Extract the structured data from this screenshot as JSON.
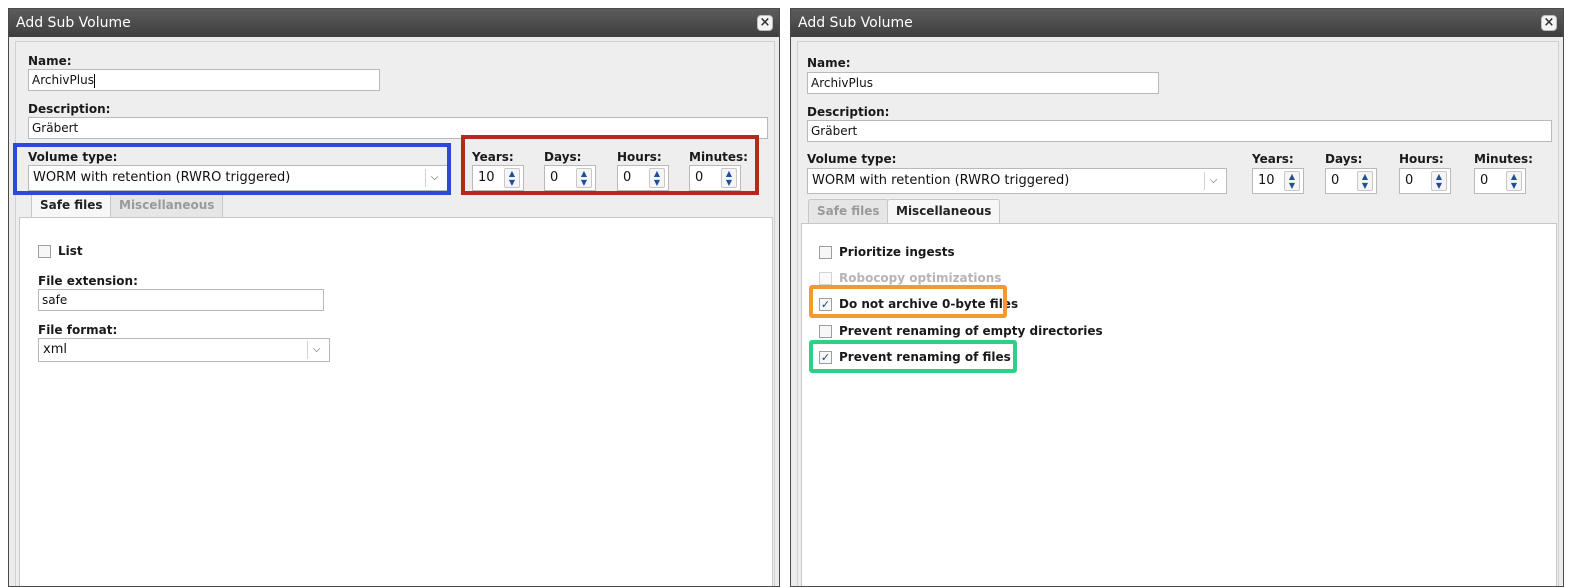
{
  "left": {
    "title": "Add Sub Volume",
    "close_glyph": "×",
    "name_label": "Name:",
    "name_value": "ArchivPlus",
    "description_label": "Description:",
    "description_value": "Gräbert",
    "volume_type_label": "Volume type:",
    "volume_type_value": "WORM with retention (RWRO triggered)",
    "retention": {
      "years_label": "Years:",
      "years": "10",
      "days_label": "Days:",
      "days": "0",
      "hours_label": "Hours:",
      "hours": "0",
      "minutes_label": "Minutes:",
      "minutes": "0"
    },
    "tabs": [
      {
        "label": "Safe files",
        "active": true
      },
      {
        "label": "Miscellaneous",
        "active": false
      }
    ],
    "safe_files": {
      "list_label": "List",
      "list_checked": false,
      "file_extension_label": "File extension:",
      "file_extension_value": "safe",
      "file_format_label": "File format:",
      "file_format_value": "xml"
    }
  },
  "right": {
    "title": "Add Sub Volume",
    "close_glyph": "×",
    "name_label": "Name:",
    "name_value": "ArchivPlus",
    "description_label": "Description:",
    "description_value": "Gräbert",
    "volume_type_label": "Volume type:",
    "volume_type_value": "WORM with retention (RWRO triggered)",
    "retention": {
      "years_label": "Years:",
      "years": "10",
      "days_label": "Days:",
      "days": "0",
      "hours_label": "Hours:",
      "hours": "0",
      "minutes_label": "Minutes:",
      "minutes": "0"
    },
    "tabs": [
      {
        "label": "Safe files",
        "active": false
      },
      {
        "label": "Miscellaneous",
        "active": true
      }
    ],
    "misc": [
      {
        "label": "Prioritize ingests",
        "checked": false,
        "disabled": false
      },
      {
        "label": "Robocopy optimizations",
        "checked": false,
        "disabled": true
      },
      {
        "label": "Do not archive 0-byte files",
        "checked": true,
        "disabled": false
      },
      {
        "label": "Prevent renaming of empty directories",
        "checked": false,
        "disabled": false
      },
      {
        "label": "Prevent renaming of files",
        "checked": true,
        "disabled": false
      }
    ]
  },
  "icons": {
    "close": "close-icon",
    "dropdown": "chevron-down-icon",
    "spinner": "spinner-arrows-icon",
    "check": "✓"
  },
  "highlight_colors": {
    "volume_type": "#2a4bd7",
    "retention": "#b32a1b",
    "zero_byte": "#f39a2e",
    "rename_files": "#2ed086"
  }
}
